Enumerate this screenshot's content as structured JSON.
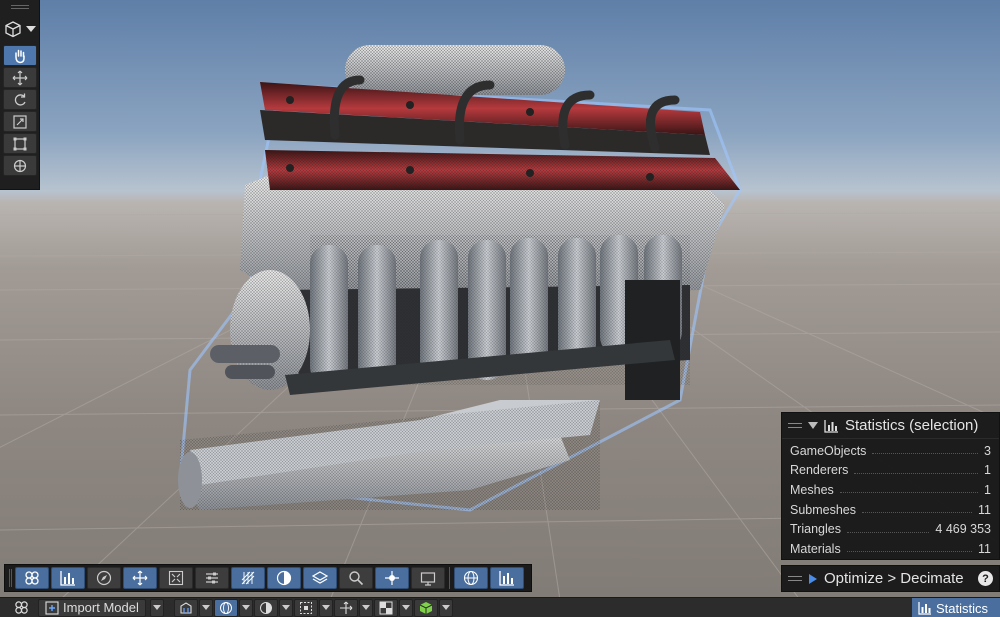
{
  "statistics": {
    "title": "Statistics (selection)",
    "rows": [
      {
        "label": "GameObjects",
        "value": "3"
      },
      {
        "label": "Renderers",
        "value": "1"
      },
      {
        "label": "Meshes",
        "value": "1"
      },
      {
        "label": "Submeshes",
        "value": "11"
      },
      {
        "label": "Triangles",
        "value": "4 469 353"
      },
      {
        "label": "Materials",
        "value": "11"
      }
    ]
  },
  "optimize": {
    "label": "Optimize > Decimate",
    "help": "?"
  },
  "statusbar": {
    "import_label": "Import Model",
    "statistics_tab": "Statistics"
  },
  "colors": {
    "accent": "#4a6f9e",
    "active_tool": "#4d77ad",
    "panel": "#181818"
  },
  "left_toolbar": [
    "view-cube-icon",
    "hand-icon",
    "move-icon",
    "rotate-icon",
    "scale-icon",
    "rect-icon",
    "transform-icon"
  ],
  "bottom_toolbar": [
    "mesh-icon",
    "bar-chart-icon",
    "compass-icon",
    "move-arrows-icon",
    "shrink-icon",
    "sliders-icon",
    "grid-scatter-icon",
    "half-sphere-icon",
    "layers-icon",
    "search-icon",
    "fit-icon",
    "camera-icon",
    "wireframe-sphere-icon",
    "statistics-icon"
  ]
}
